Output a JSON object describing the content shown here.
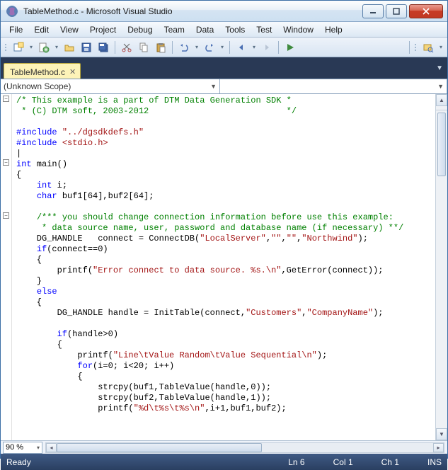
{
  "window": {
    "title": "TableMethod.c - Microsoft Visual Studio"
  },
  "menu": [
    "File",
    "Edit",
    "View",
    "Project",
    "Debug",
    "Team",
    "Data",
    "Tools",
    "Test",
    "Window",
    "Help"
  ],
  "tabs": {
    "active": "TableMethod.c"
  },
  "scope": {
    "text": "(Unknown Scope)"
  },
  "zoom": {
    "value": "90 %"
  },
  "status": {
    "ready": "Ready",
    "line": "Ln 6",
    "col": "Col 1",
    "ch": "Ch 1",
    "ins": "INS"
  },
  "code": {
    "l1a": "/* This example is a part of DTM Data Generation SDK *",
    "l2a": " * (C) DTM soft, 2003-2012                           */",
    "l3": "",
    "l4a": "#include",
    "l4b": " ",
    "l4c": "\"../dgsdkdefs.h\"",
    "l5a": "#include",
    "l5b": " ",
    "l5c": "<stdio.h>",
    "l6": "|",
    "l7a": "int",
    "l7b": " main()",
    "l8": "{",
    "l9a": "    ",
    "l9b": "int",
    "l9c": " i;",
    "l10a": "    ",
    "l10b": "char",
    "l10c": " buf1[64],buf2[64];",
    "l11": "",
    "l12a": "    ",
    "l12b": "/*** you should change connection information before use this example:",
    "l13a": "     * data source name, user, password and database name (if necessary) **/",
    "l14a": "    DG_HANDLE   connect = ConnectDB(",
    "l14b": "\"LocalServer\"",
    "l14c": ",",
    "l14d": "\"\"",
    "l14e": ",",
    "l14f": "\"\"",
    "l14g": ",",
    "l14h": "\"Northwind\"",
    "l14i": ");",
    "l15a": "    ",
    "l15b": "if",
    "l15c": "(connect==0)",
    "l16": "    {",
    "l17a": "        printf(",
    "l17b": "\"Error connect to data source. %s.\\n\"",
    "l17c": ",GetError(connect));",
    "l18": "    }",
    "l19a": "    ",
    "l19b": "else",
    "l20": "    {",
    "l21a": "        DG_HANDLE handle = InitTable(connect,",
    "l21b": "\"Customers\"",
    "l21c": ",",
    "l21d": "\"CompanyName\"",
    "l21e": ");",
    "l22": "",
    "l23a": "        ",
    "l23b": "if",
    "l23c": "(handle>0)",
    "l24": "        {",
    "l25a": "            printf(",
    "l25b": "\"Line\\tValue Random\\tValue Sequential\\n\"",
    "l25c": ");",
    "l26a": "            ",
    "l26b": "for",
    "l26c": "(i=0; i<20; i++)",
    "l27": "            {",
    "l28a": "                strcpy(buf1,TableValue(handle,0));",
    "l29a": "                strcpy(buf2,TableValue(handle,1));",
    "l30a": "                printf(",
    "l30b": "\"%d\\t%s\\t%s\\n\"",
    "l30c": ",i+1,buf1,buf2);"
  }
}
